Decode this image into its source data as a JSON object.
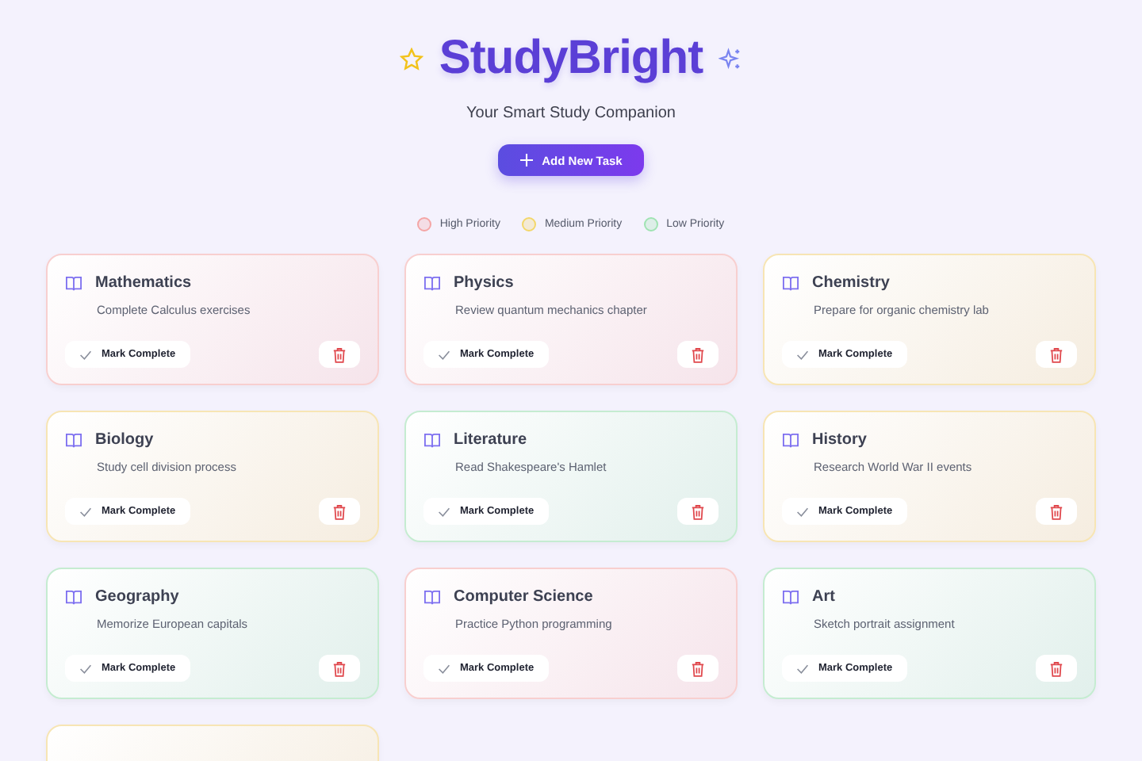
{
  "header": {
    "title": "StudyBright",
    "subtitle": "Your Smart Study Companion",
    "add_button": "Add New Task"
  },
  "legend": [
    {
      "color": "#f4a5a5",
      "label": "High Priority"
    },
    {
      "color": "#f3d76a",
      "label": "Medium Priority"
    },
    {
      "color": "#9fe3b2",
      "label": "Low Priority"
    }
  ],
  "tasks": [
    {
      "color": "#f8cfcf",
      "subject": "Mathematics",
      "description": "Complete Calculus exercises",
      "action": "Mark Complete"
    },
    {
      "color": "#f8cfcf",
      "subject": "Physics",
      "description": "Review quantum mechanics chapter",
      "action": "Mark Complete"
    },
    {
      "color": "#f7e5b4",
      "subject": "Chemistry",
      "description": "Prepare for organic chemistry lab",
      "action": "Mark Complete"
    },
    {
      "color": "#f7e5b4",
      "subject": "Biology",
      "description": "Study cell division process",
      "action": "Mark Complete"
    },
    {
      "color": "#c5ecd1",
      "subject": "Literature",
      "description": "Read Shakespeare's Hamlet",
      "action": "Mark Complete"
    },
    {
      "color": "#f7e5b4",
      "subject": "History",
      "description": "Research World War II events",
      "action": "Mark Complete"
    },
    {
      "color": "#c5ecd1",
      "subject": "Geography",
      "description": "Memorize European capitals",
      "action": "Mark Complete"
    },
    {
      "color": "#f8cfcf",
      "subject": "Computer Science",
      "description": "Practice Python programming",
      "action": "Mark Complete"
    },
    {
      "color": "#c5ecd1",
      "subject": "Art",
      "description": "Sketch portrait assignment",
      "action": "Mark Complete"
    }
  ],
  "partial_card": {
    "color": "#f7e5b4"
  }
}
